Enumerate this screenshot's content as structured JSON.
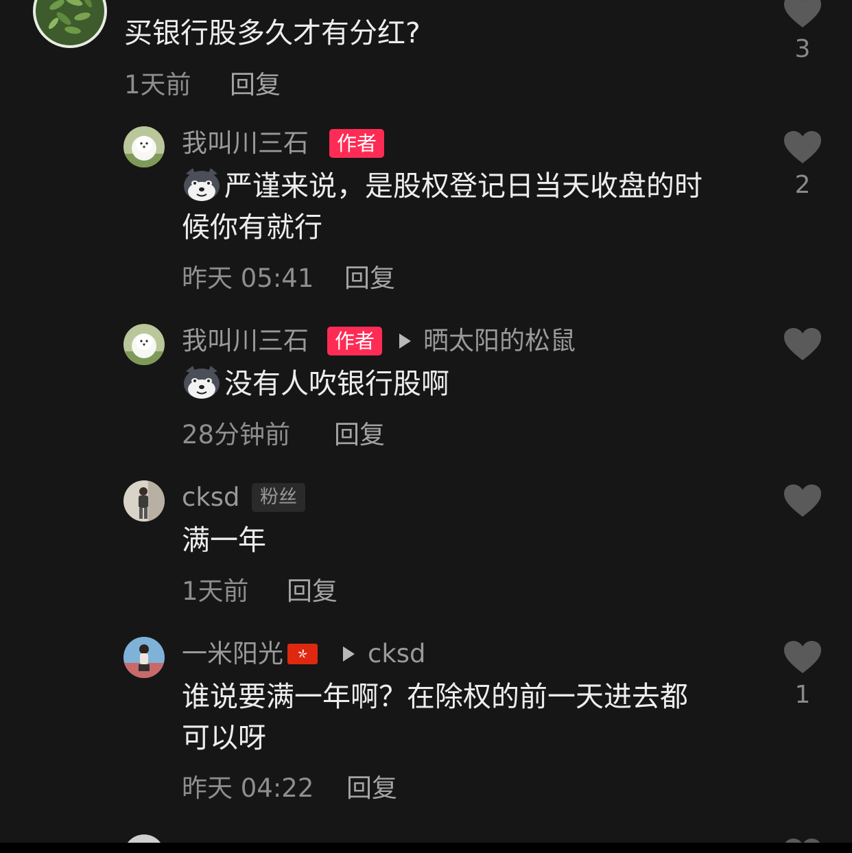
{
  "comments": [
    {
      "text": "买银行股多久才有分红?",
      "time": "1天前",
      "reply_label": "回复",
      "likes": "3"
    },
    {
      "user": "我叫川三石",
      "badge": "作者",
      "text_line1": "严谨来说，是股权登记日当天收盘的时",
      "text_line2": "候你有就行",
      "time": "昨天 05:41",
      "reply_label": "回复",
      "likes": "2"
    },
    {
      "user": "我叫川三石",
      "badge": "作者",
      "reply_to": "晒太阳的松鼠",
      "text": "没有人吹银行股啊",
      "time": "28分钟前",
      "reply_label": "回复",
      "likes": ""
    },
    {
      "user": "cksd",
      "badge": "粉丝",
      "text": "满一年",
      "time": "1天前",
      "reply_label": "回复",
      "likes": ""
    },
    {
      "user": "一米阳光",
      "reply_to": "cksd",
      "text_line1": "谁说要满一年啊？在除权的前一天进去都",
      "text_line2": "可以呀",
      "time": "昨天 04:22",
      "reply_label": "回复",
      "likes": "1"
    }
  ],
  "icons": {
    "like": "heart-icon",
    "reply_arrow": "triangle-right-icon",
    "emoji": "husky-doge-emoji",
    "flag": "hong-kong-flag"
  },
  "colors": {
    "background": "#161616",
    "author_badge": "#fe2c55",
    "fan_badge": "#2a2a2a",
    "heart": "#5a5a5a"
  }
}
